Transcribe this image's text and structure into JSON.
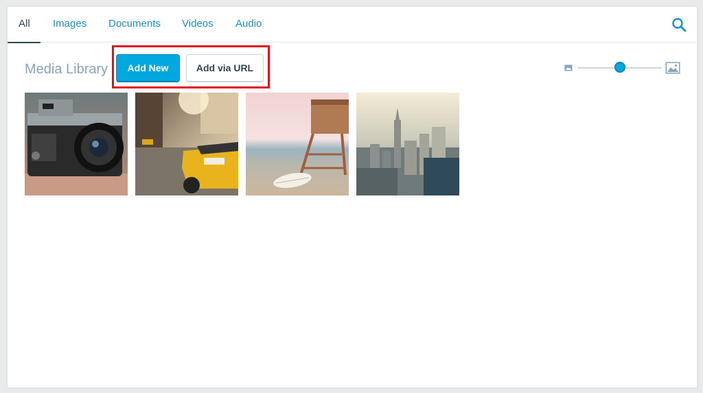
{
  "tabs": [
    {
      "label": "All",
      "active": true
    },
    {
      "label": "Images",
      "active": false
    },
    {
      "label": "Documents",
      "active": false
    },
    {
      "label": "Videos",
      "active": false
    },
    {
      "label": "Audio",
      "active": false
    }
  ],
  "header": {
    "title": "Media Library",
    "add_new_label": "Add New",
    "add_url_label": "Add via URL"
  },
  "zoom": {
    "value_fraction": 0.5,
    "small_icon": "image-small-icon",
    "large_icon": "image-large-icon"
  },
  "toolbar": {
    "search_icon": "search-icon"
  },
  "media_items": [
    {
      "subject": "vintage-camera"
    },
    {
      "subject": "yellow-taxi-street"
    },
    {
      "subject": "lifeguard-tower-beach"
    },
    {
      "subject": "city-skyline"
    }
  ],
  "colors": {
    "accent": "#00a8e0",
    "link": "#1a91c9",
    "highlight": "#e3101e",
    "text_dark": "#2e4453",
    "title": "#87a6bc"
  }
}
